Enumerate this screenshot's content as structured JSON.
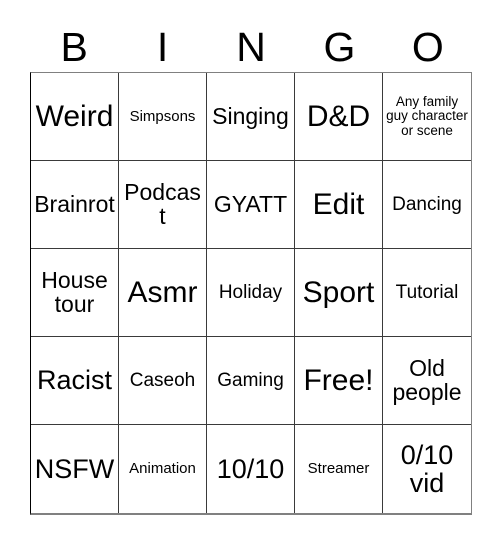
{
  "card": {
    "header_letters": [
      "B",
      "I",
      "N",
      "G",
      "O"
    ],
    "rows": [
      [
        {
          "text": "Weird",
          "size": "fs-xl"
        },
        {
          "text": "Simpsons",
          "size": "fs-xs"
        },
        {
          "text": "Singing",
          "size": "fs-md"
        },
        {
          "text": "D&D",
          "size": "fs-xl"
        },
        {
          "text": "Any family guy character or scene",
          "size": "fs-xxs"
        }
      ],
      [
        {
          "text": "Brainrot",
          "size": "fs-md"
        },
        {
          "text": "Podcast",
          "size": "fs-md"
        },
        {
          "text": "GYATT",
          "size": "fs-md"
        },
        {
          "text": "Edit",
          "size": "fs-xl"
        },
        {
          "text": "Dancing",
          "size": "fs-sm"
        }
      ],
      [
        {
          "text": "House tour",
          "size": "fs-md"
        },
        {
          "text": "Asmr",
          "size": "fs-xl"
        },
        {
          "text": "Holiday",
          "size": "fs-sm"
        },
        {
          "text": "Sport",
          "size": "fs-xl"
        },
        {
          "text": "Tutorial",
          "size": "fs-sm"
        }
      ],
      [
        {
          "text": "Racist",
          "size": "fs-lg"
        },
        {
          "text": "Caseoh",
          "size": "fs-sm"
        },
        {
          "text": "Gaming",
          "size": "fs-sm"
        },
        {
          "text": "Free!",
          "size": "fs-xl"
        },
        {
          "text": "Old people",
          "size": "fs-md"
        }
      ],
      [
        {
          "text": "NSFW",
          "size": "fs-lg"
        },
        {
          "text": "Animation",
          "size": "fs-xs"
        },
        {
          "text": "10/10",
          "size": "fs-lg"
        },
        {
          "text": "Streamer",
          "size": "fs-xs"
        },
        {
          "text": "0/10 vid",
          "size": "fs-lg"
        }
      ]
    ]
  },
  "colors": {
    "background": "#ffffff",
    "text": "#000000",
    "grid_line": "#3a3a3a",
    "outer_border": "#808080"
  }
}
